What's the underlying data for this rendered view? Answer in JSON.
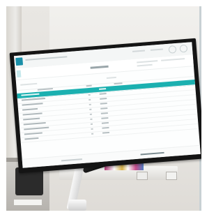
{
  "scene": {
    "subject": "wall-mounted-monitor-in-clinic",
    "colors": {
      "accent": "#1bb0b0",
      "bezel": "#141414",
      "screen": "#fdfefe",
      "wall": "#e8e6e2"
    }
  },
  "screen_app": {
    "header": {
      "icons": [
        "app-logo-icon",
        "settings-icon",
        "user-icon"
      ]
    },
    "table": {
      "highlighted_row_index": 0,
      "row_count": 10
    }
  }
}
